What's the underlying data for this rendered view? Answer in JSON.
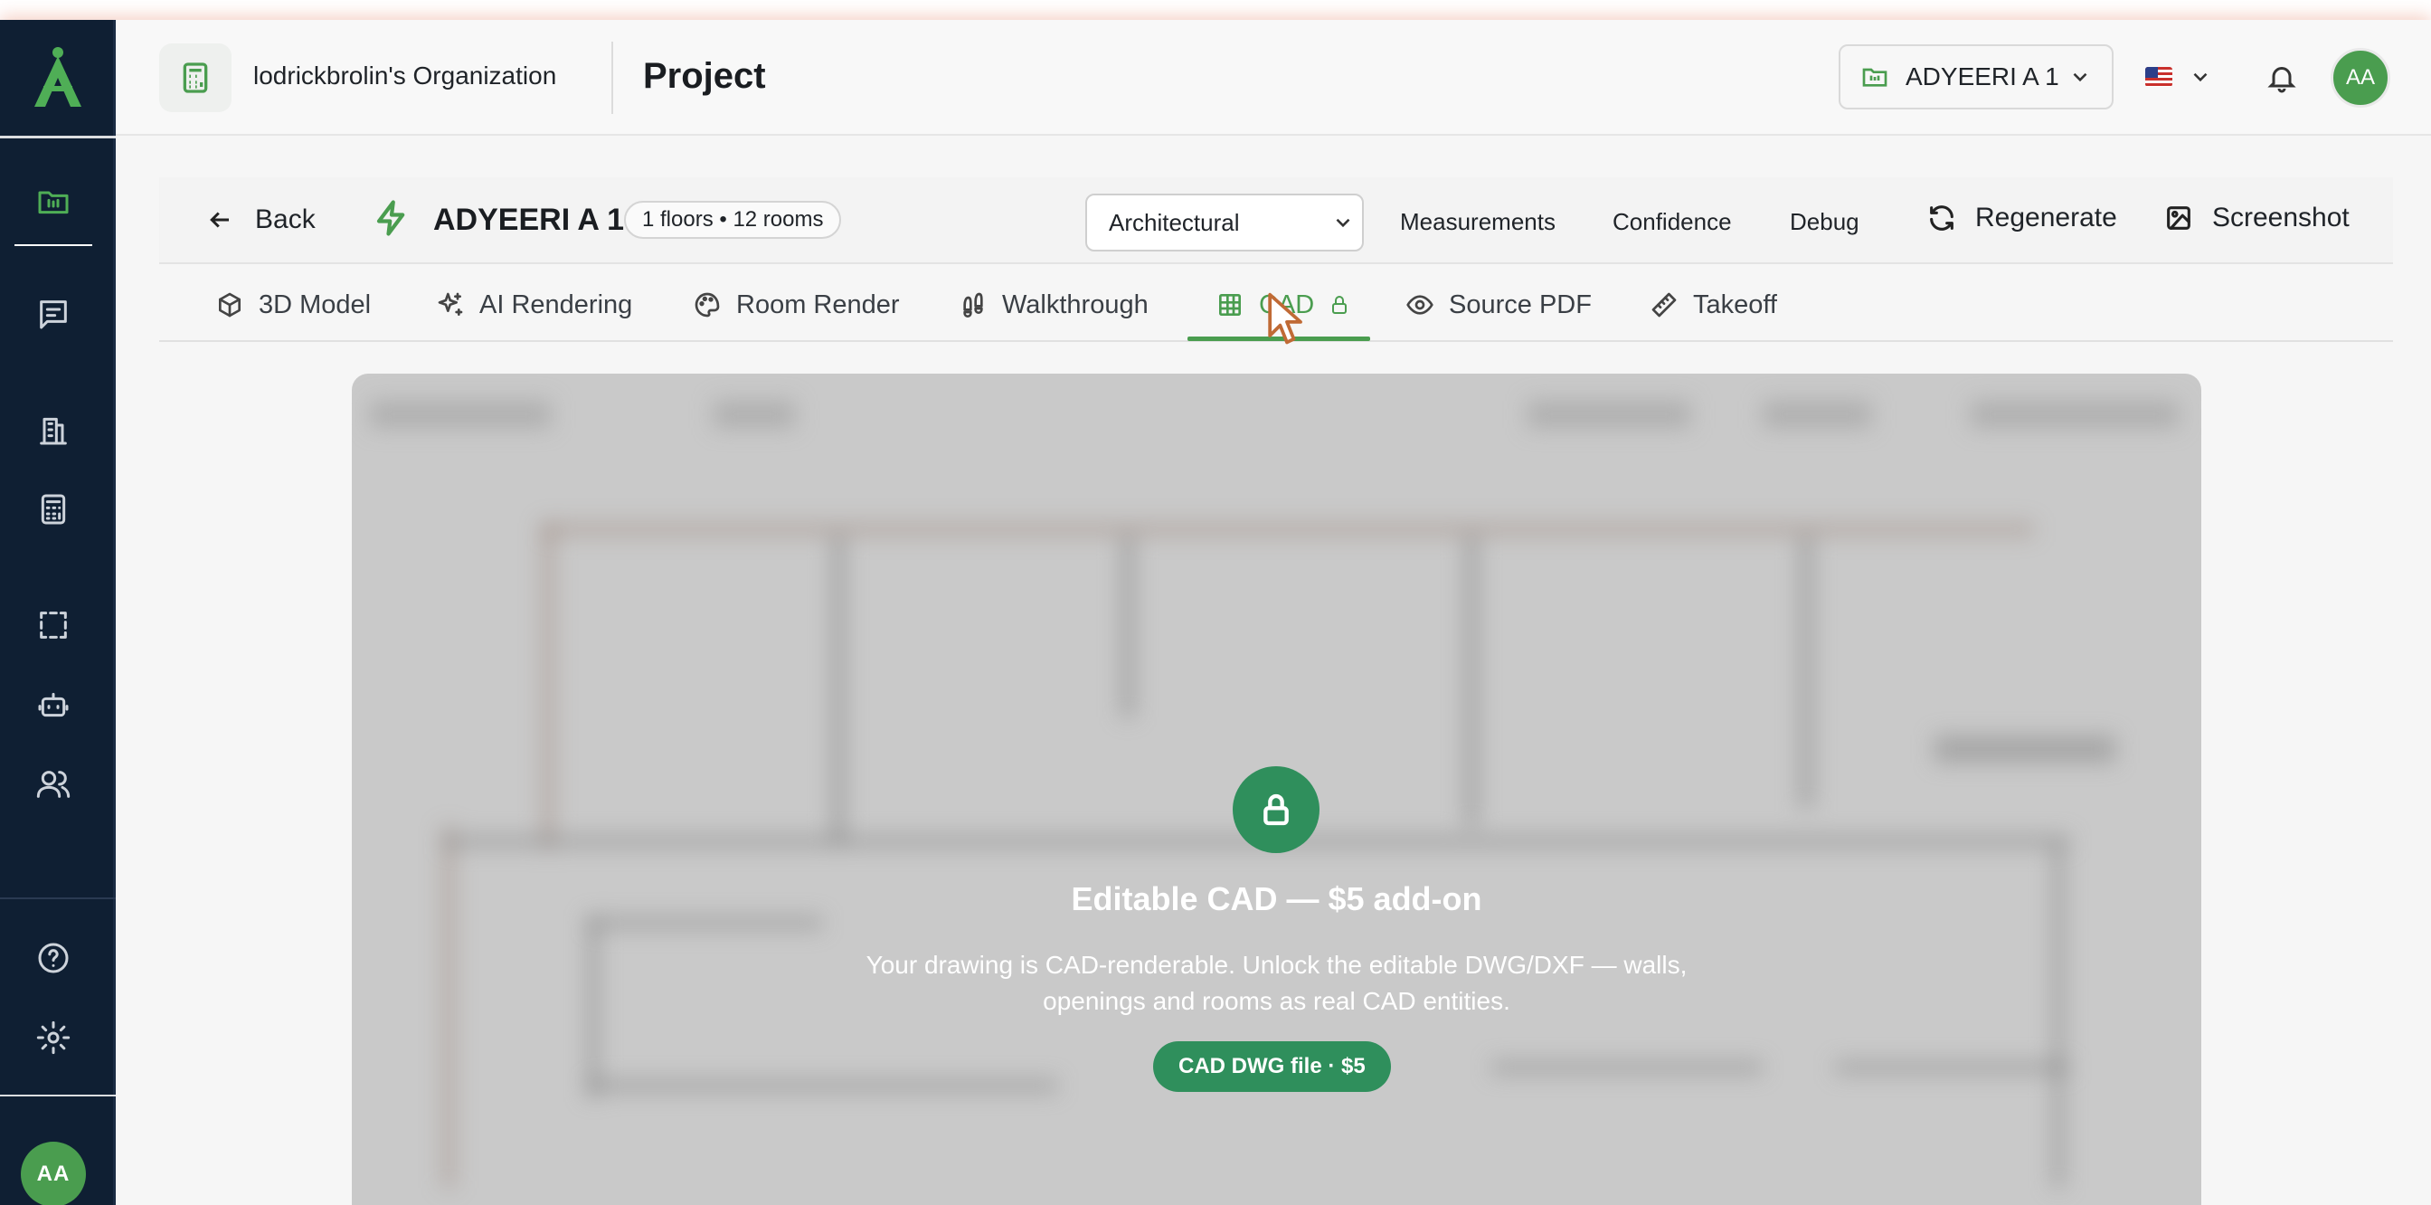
{
  "header": {
    "org_name": "lodrickbrolin's Organization",
    "page_title": "Project",
    "project_select": "ADYEERI A 1",
    "user_initials": "AA"
  },
  "sidebar": {
    "user_initials": "AA",
    "items": [
      {
        "icon": "projects-icon",
        "active": true
      },
      {
        "icon": "messages-icon"
      },
      {
        "icon": "building-icon"
      },
      {
        "icon": "calculator-icon"
      },
      {
        "icon": "selection-icon"
      },
      {
        "icon": "bot-icon"
      },
      {
        "icon": "users-icon"
      },
      {
        "icon": "help-icon"
      },
      {
        "icon": "settings-icon"
      }
    ]
  },
  "toolbar": {
    "back_label": "Back",
    "title": "ADYEERI A 1",
    "stats_pill": "1 floors • 12 rooms",
    "view_select": "Architectural",
    "links": [
      "Measurements",
      "Confidence",
      "Debug"
    ],
    "regenerate_label": "Regenerate",
    "screenshot_label": "Screenshot"
  },
  "tabs": [
    {
      "label": "3D Model",
      "icon": "cube-icon"
    },
    {
      "label": "AI Rendering",
      "icon": "sparkles-icon"
    },
    {
      "label": "Room Render",
      "icon": "palette-icon"
    },
    {
      "label": "Walkthrough",
      "icon": "footprints-icon"
    },
    {
      "label": "CAD",
      "icon": "grid-icon",
      "active": true,
      "locked": true
    },
    {
      "label": "Source PDF",
      "icon": "eye-icon"
    },
    {
      "label": "Takeoff",
      "icon": "ruler-icon"
    }
  ],
  "locked_overlay": {
    "title": "Editable CAD — $5 add-on",
    "description": "Your drawing is CAD-renderable. Unlock the editable DWG/DXF — walls, openings and rooms as real CAD entities.",
    "button_label": "CAD DWG file · $5"
  },
  "colors": {
    "accent": "#4a9d4f",
    "cta": "#2f8f5c",
    "sidebar_bg": "#0f1f33"
  }
}
